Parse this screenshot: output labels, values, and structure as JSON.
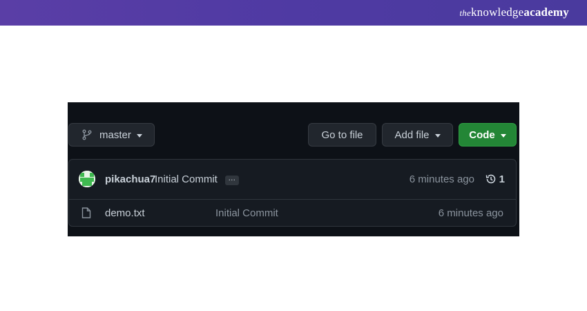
{
  "banner": {
    "logo_prefix": "the",
    "logo_main": "knowledge",
    "logo_bold": "academy"
  },
  "toolbar": {
    "branch_name": "master",
    "goto_label": "Go to file",
    "addfile_label": "Add file",
    "code_label": "Code"
  },
  "commit": {
    "author": "pikachua7",
    "message": "Initial Commit",
    "ellipsis": "…",
    "time": "6 minutes ago",
    "history_count": "1"
  },
  "files": [
    {
      "name": "demo.txt",
      "commit_message": "Initial Commit",
      "time": "6 minutes ago"
    }
  ],
  "colors": {
    "banner": "#5a3ea6",
    "panel_bg": "#0d1117",
    "code_button": "#238636"
  },
  "icons": {
    "branch": "git-branch-icon",
    "history": "history-icon",
    "file": "file-icon",
    "avatar": "avatar"
  }
}
